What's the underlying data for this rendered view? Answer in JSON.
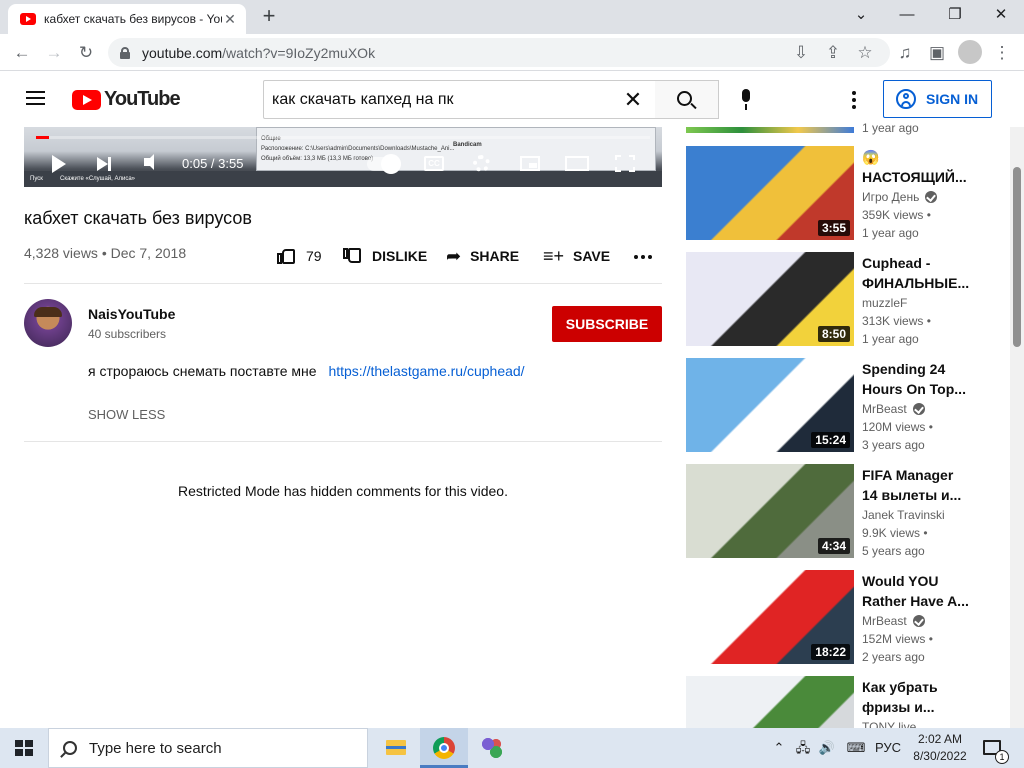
{
  "browser": {
    "tab_title": "кабхет скачать без вирусов - YouTube",
    "url_host": "youtube.com",
    "url_path": "/watch?v=9IoZy2muXOk"
  },
  "header": {
    "logo_text": "YouTube",
    "search_query": "как скачать капхед на пк",
    "signin_label": "SIGN IN"
  },
  "player": {
    "time_display": "0:05 / 3:55",
    "progress_fraction": 0.021,
    "doc_lines": [
      "Общие",
      "Расположение: C:\\Users\\admin\\Documents\\Downloads\\Mustache_Ani...",
      "Общий объём: 13,3 МБ (13,3 МБ готово)"
    ],
    "overlay_dialog": "Bandicam",
    "taskbar_start": "Пуск",
    "taskbar_hint": "Скажите «Слушай, Алиса»"
  },
  "video": {
    "title": "кабхет скачать без вирусов",
    "views_date": "4,328 views • Dec 7, 2018",
    "like_count": "79",
    "dislike_label": "DISLIKE",
    "share_label": "SHARE",
    "save_label": "SAVE"
  },
  "channel": {
    "name": "NaisYouTube",
    "subscribers": "40 subscribers",
    "subscribe_label": "SUBSCRIBE"
  },
  "description": {
    "text": "я строраюсь снемать поставте мне",
    "link": "https://thelastgame.ru/cuphead/",
    "show_less": "SHOW LESS"
  },
  "comments": {
    "restricted_notice": "Restricted Mode has hidden comments for this video."
  },
  "sidebar": {
    "first_item_age": "1 year ago",
    "items": [
      {
        "title_line1": "😱",
        "title_line2": "НАСТОЯЩИЙ...",
        "channel": "Игро День",
        "verified": true,
        "views": "359K views •",
        "age": "1 year ago",
        "duration": "3:55",
        "thumb_colors": [
          "#3b7fd0",
          "#f0c03a",
          "#c0392b"
        ]
      },
      {
        "title_line1": "Cuphead -",
        "title_line2": "ФИНАЛЬНЫЕ...",
        "channel": "muzzleF",
        "verified": false,
        "views": "313K views •",
        "age": "1 year ago",
        "duration": "8:50",
        "thumb_colors": [
          "#e8e8f4",
          "#2a2a2a",
          "#f2d23b"
        ]
      },
      {
        "title_line1": "Spending 24",
        "title_line2": "Hours On Top...",
        "channel": "MrBeast",
        "verified": true,
        "views": "120M views •",
        "age": "3 years ago",
        "duration": "15:24",
        "thumb_colors": [
          "#6fb3e8",
          "#ffffff",
          "#1f2b3a"
        ]
      },
      {
        "title_line1": "FIFA Manager",
        "title_line2": "14 вылеты и...",
        "channel": "Janek Travinski",
        "verified": false,
        "views": "9.9K views •",
        "age": "5 years ago",
        "duration": "4:34",
        "thumb_colors": [
          "#d9ddd2",
          "#4f6b3c",
          "#8a8f86"
        ]
      },
      {
        "title_line1": "Would YOU",
        "title_line2": "Rather Have A...",
        "channel": "MrBeast",
        "verified": true,
        "views": "152M views •",
        "age": "2 years ago",
        "duration": "18:22",
        "thumb_colors": [
          "#ffffff",
          "#e02424",
          "#2c3e50"
        ]
      },
      {
        "title_line1": "Как убрать",
        "title_line2": "фризы и...",
        "channel": "TONY live",
        "verified": false,
        "views": "",
        "age": "",
        "duration": "",
        "thumb_colors": [
          "#eef1f4",
          "#4a8a3a",
          "#d6d9dc"
        ]
      }
    ]
  },
  "taskbar": {
    "search_placeholder": "Type here to search",
    "language": "РУС",
    "time": "2:02 AM",
    "date": "8/30/2022",
    "notification_count": "1"
  }
}
